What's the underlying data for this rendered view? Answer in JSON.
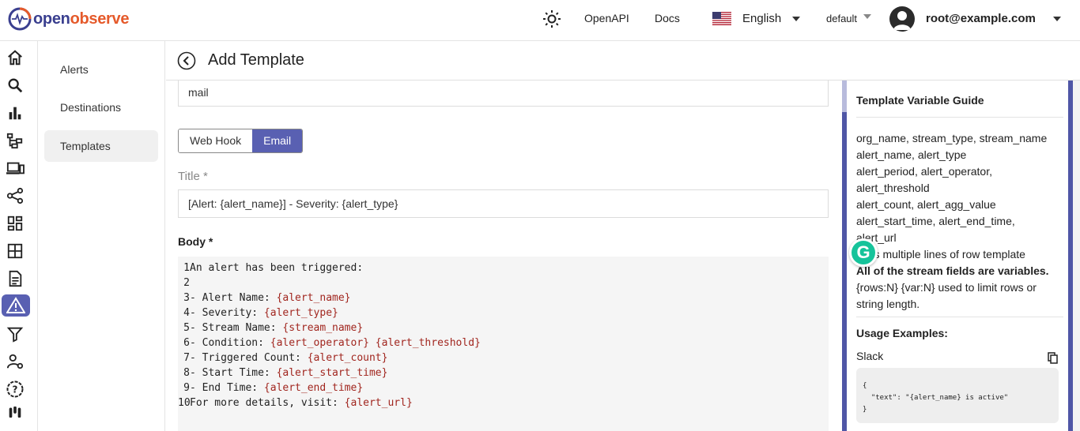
{
  "header": {
    "logo_open": "open",
    "logo_observe": "observe",
    "openapi": "OpenAPI",
    "docs": "Docs",
    "language": "English",
    "org": "default",
    "user": "root@example.com"
  },
  "leftnav": {
    "icons": [
      "home-icon",
      "search-icon",
      "metrics-icon",
      "traces-icon",
      "rum-icon",
      "pipeline-icon",
      "dashboards-icon",
      "streams-icon",
      "reports-icon",
      "alerts-icon",
      "functions-icon",
      "iam-icon",
      "settings-icon",
      "slack-icon"
    ],
    "active": "alerts-icon"
  },
  "subnav": {
    "items": [
      "Alerts",
      "Destinations",
      "Templates"
    ],
    "active": "Templates"
  },
  "page": {
    "title": "Add Template"
  },
  "form": {
    "name_value": "mail",
    "type_options": [
      "Web Hook",
      "Email"
    ],
    "type_selected": "Email",
    "title_label": "Title *",
    "title_value": "[Alert: {alert_name}] - Severity: {alert_type}",
    "body_label": "Body *",
    "body_lines": [
      {
        "n": "1",
        "text": "An alert has been triggered:",
        "var": ""
      },
      {
        "n": "2",
        "text": "",
        "var": ""
      },
      {
        "n": "3",
        "text": "- Alert Name: ",
        "var": "{alert_name}"
      },
      {
        "n": "4",
        "text": "- Severity: ",
        "var": "{alert_type}"
      },
      {
        "n": "5",
        "text": "- Stream Name: ",
        "var": "{stream_name}"
      },
      {
        "n": "6",
        "text": "- Condition: ",
        "var": "{alert_operator} {alert_threshold}"
      },
      {
        "n": "7",
        "text": "- Triggered Count: ",
        "var": "{alert_count}"
      },
      {
        "n": "8",
        "text": "- Start Time: ",
        "var": "{alert_start_time}"
      },
      {
        "n": "9",
        "text": "- End Time: ",
        "var": "{alert_end_time}"
      },
      {
        "n": "10",
        "text": "For more details, visit: ",
        "var": "{alert_url}"
      }
    ]
  },
  "guide": {
    "title": "Template Variable Guide",
    "lines": [
      "org_name, stream_type, stream_name",
      "alert_name, alert_type",
      "alert_period, alert_operator,",
      "alert_threshold",
      "alert_count, alert_agg_value",
      "alert_start_time, alert_end_time,",
      "alert_url",
      "rows multiple lines of row template"
    ],
    "bold_line": "All of the stream fields are variables.",
    "limit_line_1": "{rows:N} {var:N} used to limit rows or",
    "limit_line_2": "string length.",
    "usage_title": "Usage Examples:",
    "slack_label": "Slack",
    "slack_code_1": "{",
    "slack_code_2": "  \"text\": \"{alert_name} is active\"",
    "slack_code_3": "}"
  },
  "colors": {
    "accent": "#5960b2",
    "variable": "#a1261f"
  }
}
